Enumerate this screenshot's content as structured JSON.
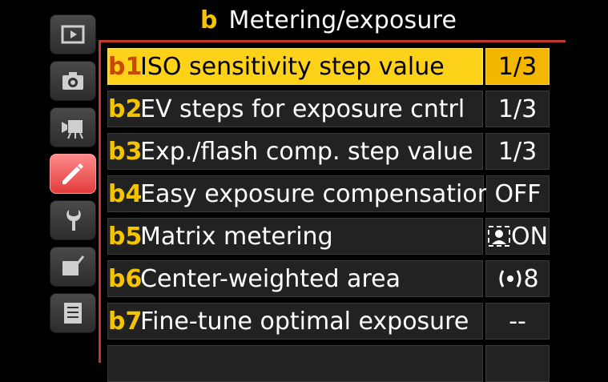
{
  "title": {
    "code": "b",
    "text": "Metering/exposure"
  },
  "sidebar": {
    "items": [
      {
        "icon": "playback-icon"
      },
      {
        "icon": "camera-icon"
      },
      {
        "icon": "movie-icon"
      },
      {
        "icon": "pencil-icon",
        "active": true
      },
      {
        "icon": "wrench-icon"
      },
      {
        "icon": "retouch-icon"
      },
      {
        "icon": "my-menu-icon"
      }
    ]
  },
  "menu": {
    "rows": [
      {
        "code": "b1",
        "label": "ISO sensitivity step value",
        "value": "1/3",
        "selected": true
      },
      {
        "code": "b2",
        "label": "EV steps for exposure cntrl",
        "value": "1/3"
      },
      {
        "code": "b3",
        "label": "Exp./flash comp. step value",
        "value": "1/3"
      },
      {
        "code": "b4",
        "label": "Easy exposure compensation",
        "value": "OFF"
      },
      {
        "code": "b5",
        "label": "Matrix metering",
        "value": "ON",
        "value_icon": "face-detection-icon"
      },
      {
        "code": "b6",
        "label": "Center-weighted area",
        "value": "8",
        "value_icon": "center-weighted-icon"
      },
      {
        "code": "b7",
        "label": "Fine-tune optimal exposure",
        "value": "--"
      }
    ]
  },
  "colors": {
    "accent": "#f5c400",
    "selected_bg": "#ffd21a",
    "panel_border": "#c0392b"
  }
}
